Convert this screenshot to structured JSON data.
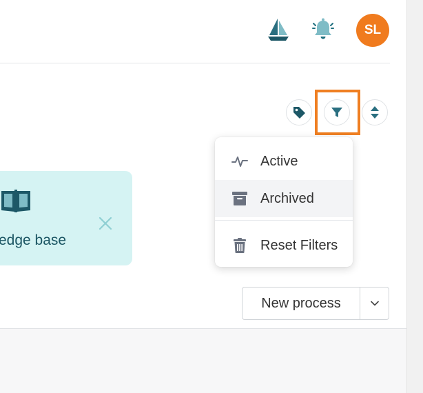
{
  "header": {
    "icons": {
      "boat": "sailboat-icon",
      "notifications": "bell-icon"
    },
    "avatar_initials": "SL"
  },
  "toolbar": {
    "buttons": [
      "tag-icon",
      "filter-icon",
      "sort-icon"
    ]
  },
  "filter_menu": {
    "items": [
      {
        "label": "Active",
        "icon": "activity-icon"
      },
      {
        "label": "Archived",
        "icon": "archive-icon"
      },
      {
        "label": "Reset Filters",
        "icon": "trash-icon"
      }
    ]
  },
  "knowledge_card": {
    "label": "edge base",
    "icon": "book-icon"
  },
  "new_process": {
    "label": "New process"
  },
  "colors": {
    "accent_teal": "#1f6f7f",
    "avatar_bg": "#f07b1e",
    "highlight": "#ef7f22",
    "card_bg": "#d5f3f3"
  }
}
